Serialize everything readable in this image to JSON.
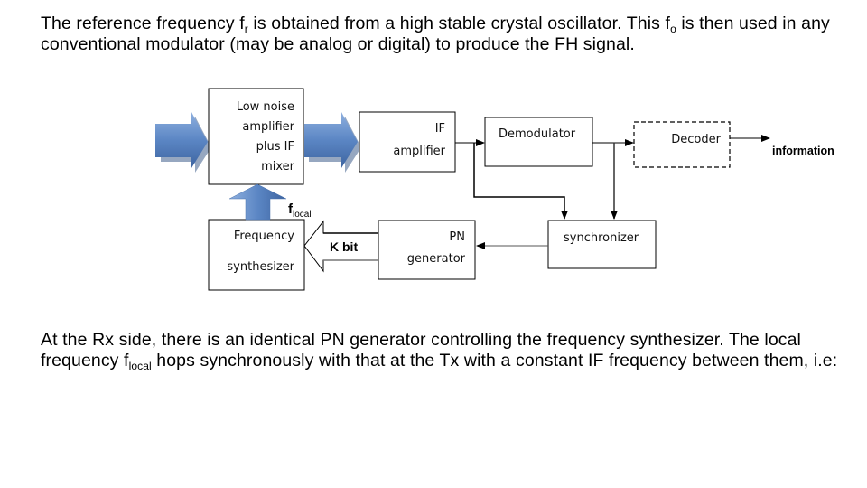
{
  "paragraph_top": {
    "part1": "The reference frequency f",
    "sub1": "r",
    "part2": " is obtained from a high stable crystal oscillator. This f",
    "sub2": "o",
    "part3": " is then used in any conventional modulator (may be analog or digital) to produce the FH signal."
  },
  "diagram": {
    "blocks": {
      "lna": [
        "Low noise",
        "amplifier",
        "plus IF",
        "mixer"
      ],
      "if_amp": [
        "IF",
        "amplifier"
      ],
      "demodulator": [
        "Demodulator"
      ],
      "decoder": [
        "Decoder"
      ],
      "freq_synth": [
        "Frequency",
        "synthesizer"
      ],
      "pn_gen": [
        "PN",
        "generator"
      ],
      "synchronizer": [
        "synchronizer"
      ]
    },
    "labels": {
      "information": "information",
      "f_local_main": "f",
      "f_local_sub": "local",
      "k_bit": "K bit"
    },
    "colors": {
      "arrow_fill": "#5b86c4",
      "arrow_dark": "#3f67a3",
      "line": "#000000"
    }
  },
  "paragraph_bottom": {
    "part1": "At the Rx side, there is an identical PN generator controlling the frequency synthesizer. The local frequency f",
    "sub1": "local",
    "part2": " hops synchronously with that at the Tx with a constant IF frequency between them, i.e:"
  }
}
